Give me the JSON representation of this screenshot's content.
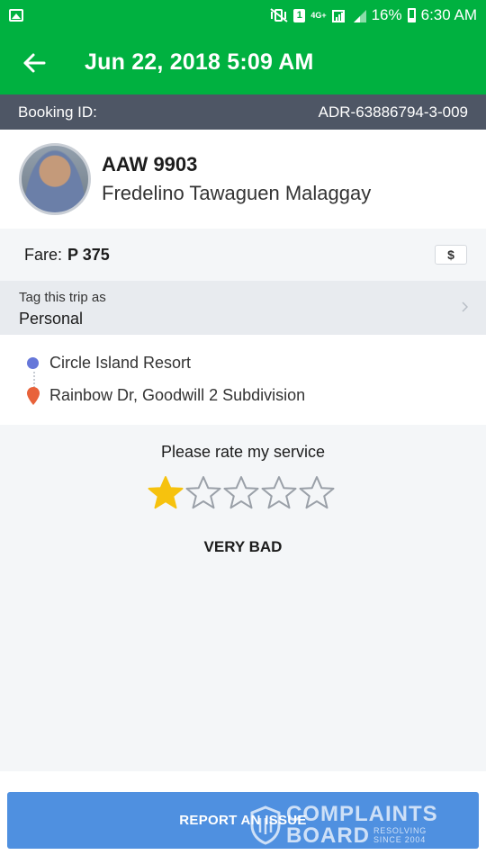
{
  "status_bar": {
    "battery": "16%",
    "time": "6:30 AM",
    "sim": "1",
    "network": "4G+",
    "icons": [
      "gallery-icon",
      "mute-vibrate-icon",
      "sim-icon",
      "signal-icon",
      "battery-icon"
    ]
  },
  "header": {
    "title": "Jun 22, 2018 5:09 AM",
    "back_icon": "arrow-left-icon"
  },
  "booking": {
    "label": "Booking ID:",
    "id": "ADR-63886794-3-009"
  },
  "driver": {
    "plate": "AAW 9903",
    "name": "Fredelino Tawaguen Malaggay"
  },
  "fare": {
    "label": "Fare:",
    "value": "P 375",
    "button_icon": "$"
  },
  "tag": {
    "title": "Tag this trip as",
    "value": "Personal"
  },
  "route": {
    "pickup": "Circle Island Resort",
    "dropoff": "Rainbow Dr, Goodwill 2 Subdivision"
  },
  "rating": {
    "prompt": "Please rate my service",
    "stars_total": 5,
    "stars_selected": 1,
    "label": "VERY BAD"
  },
  "actions": {
    "report_label": "REPORT AN ISSUE"
  },
  "watermark": {
    "line1": "COMPLAINTS",
    "line2": "BOARD",
    "tag1": "RESOLVING",
    "tag2": "SINCE 2004"
  },
  "colors": {
    "primary_green": "#00b140",
    "booking_bar": "#4e5665",
    "star_filled": "#f6c20e",
    "star_empty": "#9aa0a8",
    "report_button": "#4f90e0",
    "pickup_dot": "#6677d9",
    "dropoff_pin": "#e8623a"
  }
}
